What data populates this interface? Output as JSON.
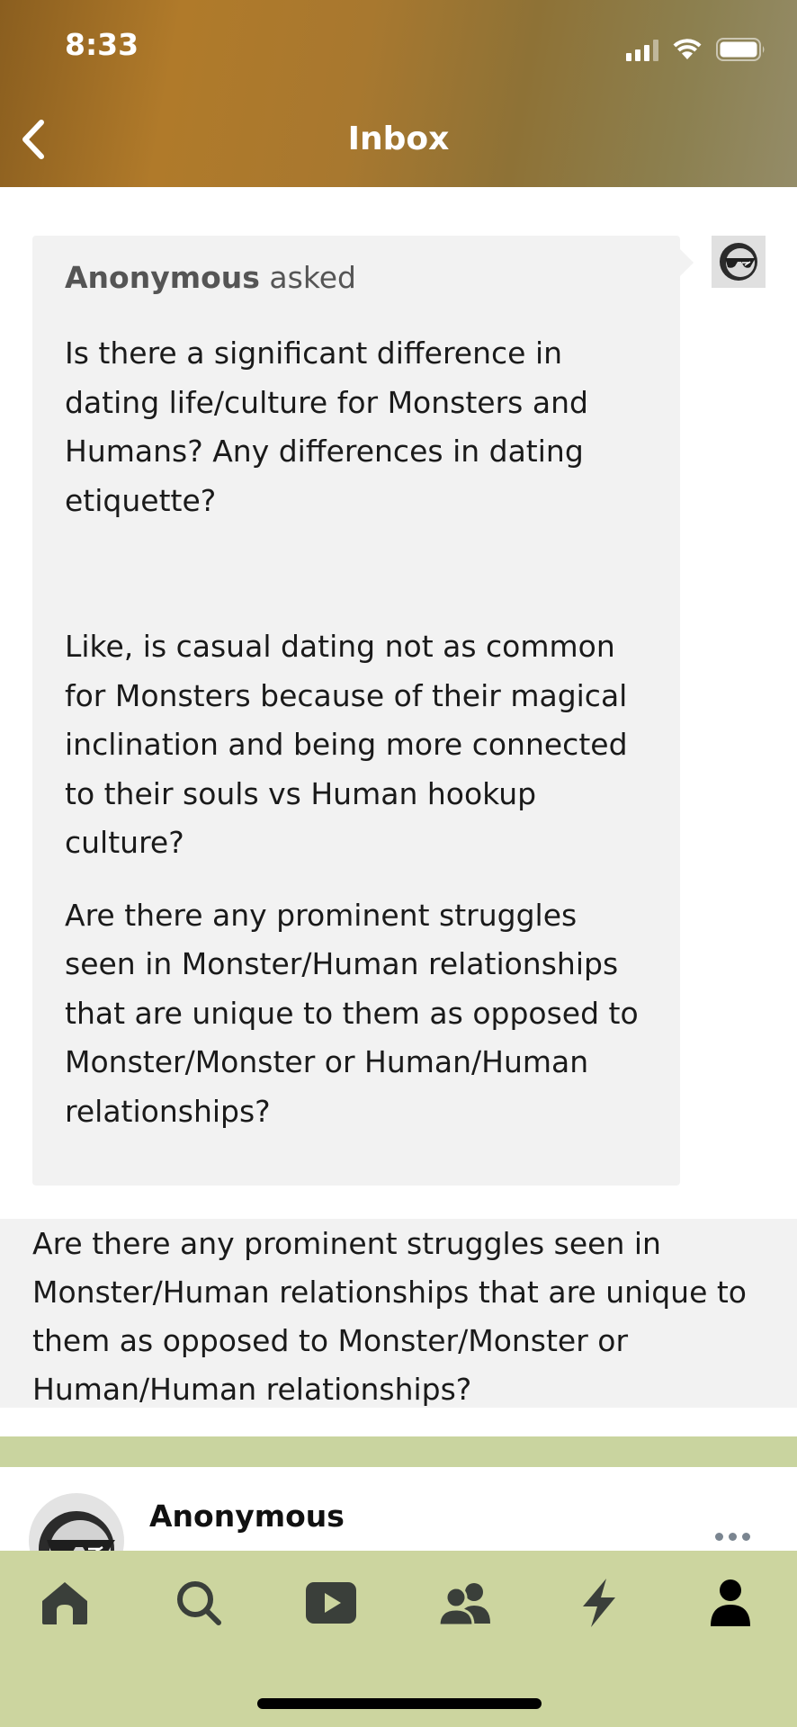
{
  "status_bar": {
    "time": "8:33"
  },
  "header": {
    "title": "Inbox"
  },
  "ask": {
    "asker_name": "Anonymous",
    "asked_label": "asked",
    "paragraphs": [
      "Is there a significant difference in dating life/culture for Monsters and Humans? Any differences in dating etiquette?",
      "Like, is casual dating not as common for Monsters because of their magical inclination and being more connected to their souls vs Human hookup culture?",
      "Are there any prominent struggles seen in Monster/Human relationships that are unique to them as opposed to Monster/Monster or Human/Human relationships?"
    ]
  },
  "answer": {
    "text": "Are there any prominent struggles seen in Monster/Human relationships that are unique to them as opposed to Monster/Monster or Human/Human relationships?"
  },
  "post": {
    "author_name": "Anonymous"
  },
  "tabbar": {
    "items": [
      "home-icon",
      "search-icon",
      "video-icon",
      "community-icon",
      "activity-icon",
      "account-icon"
    ]
  },
  "colors": {
    "tabbar_bg": "#ccd59f",
    "bubble_bg": "#f2f2f2",
    "tab_icon": "#3a3f3a",
    "accent_band": "#c9d49f"
  }
}
